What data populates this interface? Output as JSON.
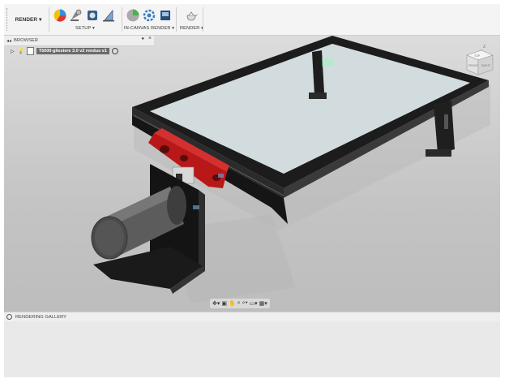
{
  "toolbar": {
    "workspace_label": "RENDER",
    "workspace_caret": "▾",
    "groups": [
      {
        "label": "SETUP ▾"
      },
      {
        "label": "IN-CANVAS RENDER ▾"
      },
      {
        "label": "RENDER ▾"
      }
    ]
  },
  "browser": {
    "header": "BROWSER",
    "collapse": "◂◂",
    "close": "×",
    "root_item": "T5000-glissiere 3.0 v2 rendus v1"
  },
  "viewcube": {
    "top": "TOP",
    "front": "FRONT",
    "right": "RIGHT",
    "axis_z": "Z"
  },
  "navbar": {
    "icons": [
      "orbit-icon",
      "lookat-icon",
      "pan-icon",
      "zoom-icon",
      "fit-icon",
      "display-icon",
      "grid-icon"
    ]
  },
  "gallery": {
    "header": "RENDERING GALLERY"
  },
  "colors": {
    "frame_black": "#1c1c1c",
    "part_red": "#b81818",
    "cylinder": "#5a5a5a",
    "viewport_bg": "#c8c8c8"
  }
}
